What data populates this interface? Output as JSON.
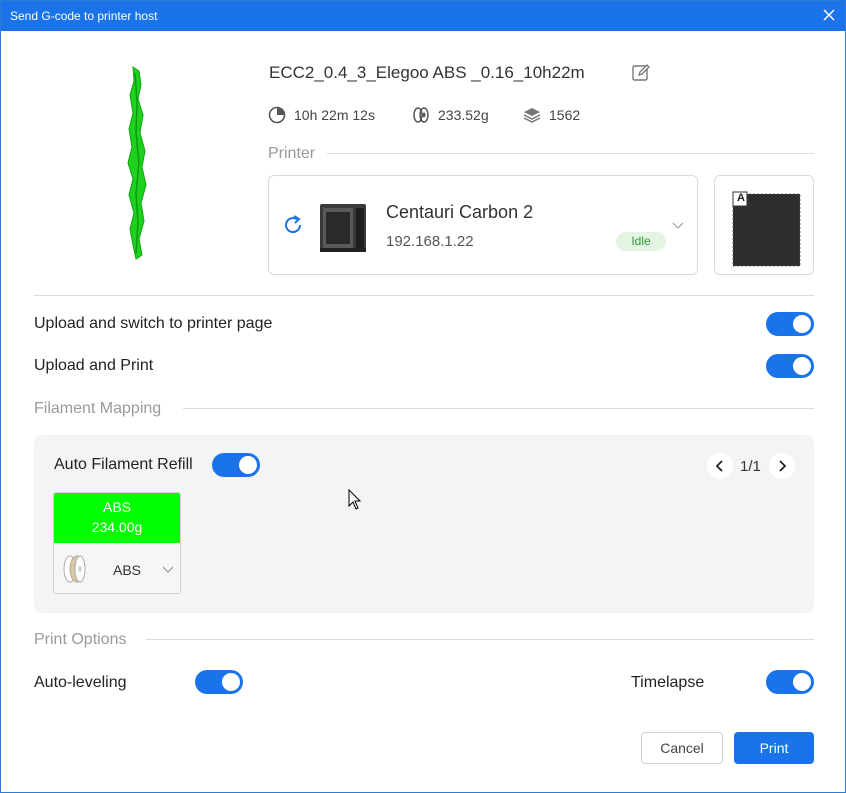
{
  "window": {
    "title": "Send G-code to printer host"
  },
  "file": {
    "name": "ECC2_0.4_3_Elegoo ABS _0.16_10h22m",
    "print_time": "10h 22m 12s",
    "filament_weight": "233.52g",
    "layers": "1562"
  },
  "printer_section": {
    "label": "Printer",
    "name": "Centauri Carbon 2",
    "ip": "192.168.1.22",
    "status": "Idle"
  },
  "plate": {
    "badge": "A"
  },
  "options": {
    "upload_switch_label": "Upload and switch to printer page",
    "upload_print_label": "Upload and Print"
  },
  "filament_mapping": {
    "label": "Filament Mapping",
    "auto_refill_label": "Auto Filament Refill",
    "page": "1/1",
    "slots": [
      {
        "material": "ABS",
        "weight": "234.00g",
        "mapped_type": "ABS",
        "color": "#00ff00"
      }
    ]
  },
  "print_options": {
    "label": "Print Options",
    "auto_leveling_label": "Auto-leveling",
    "timelapse_label": "Timelapse"
  },
  "buttons": {
    "cancel": "Cancel",
    "print": "Print"
  },
  "colors": {
    "accent": "#1a73e8",
    "idle_badge": "#e3f4e3",
    "idle_text": "#2c9a3a"
  }
}
